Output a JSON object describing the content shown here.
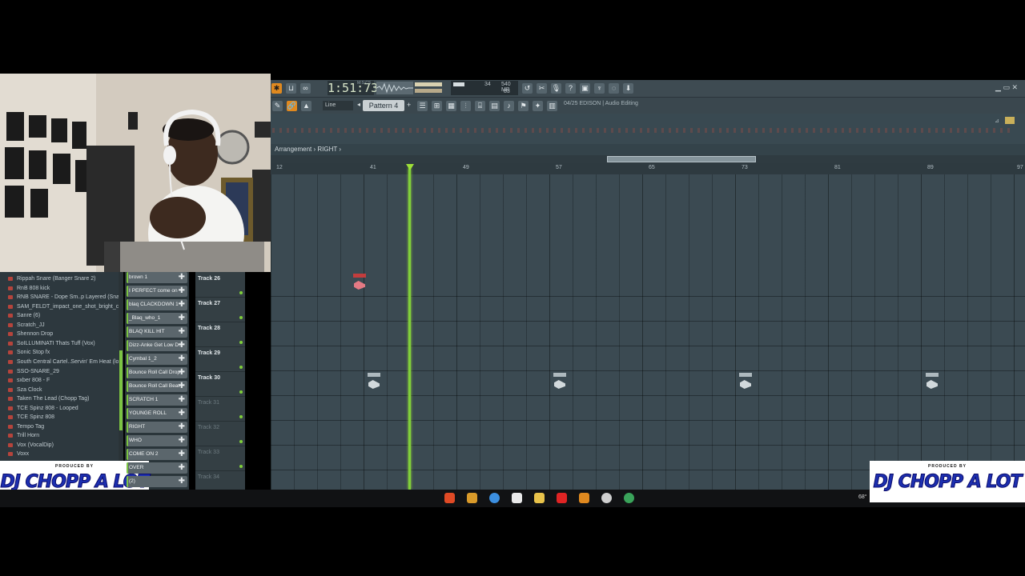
{
  "toolbar": {
    "time": "1:51:73",
    "time_label": "M:S:CS",
    "pattern": "Pattern 4",
    "snap": "Line",
    "monitor_voices": "34",
    "monitor_mem": "540 MB",
    "monitor_cpu": "83",
    "hint": "04/25 EDISON | Audio Editing"
  },
  "playlist": {
    "breadcrumb": "Arrangement › RIGHT ›",
    "tracks": [
      {
        "name": "Track 26",
        "active": true
      },
      {
        "name": "Track 27",
        "active": true
      },
      {
        "name": "Track 28",
        "active": true
      },
      {
        "name": "Track 29",
        "active": true
      },
      {
        "name": "Track 30",
        "active": true
      },
      {
        "name": "Track 31",
        "active": false
      },
      {
        "name": "Track 32",
        "active": false
      },
      {
        "name": "Track 33",
        "active": false
      },
      {
        "name": "Track 34",
        "active": false
      }
    ]
  },
  "browser": {
    "items": [
      "Rippah Snare (Banger Snare 2)",
      "RnB 808 kick",
      "RNB SNARE - Dope Sm..p Layered (Snare)_2",
      "SAM_FELDT_impact_one_shot_bright_clap",
      "Sanre (6)",
      "Scratch_JJ",
      "Shennon Drop",
      "SoILLUMINATI Thats Tuff (Vox)",
      "Sonic Stop fx",
      "South Central Cartel..Servin' Em Heat (loop)",
      "SSO-SNARE_29",
      "sxber 808 - F",
      "Sza Clock",
      "Taken The Lead (Chopp Tag)",
      "TCE Spinz 808 - Looped",
      "TCE Spinz 808",
      "Tempo Tag",
      "Trill Horn",
      "Vox (VocalDip)",
      "Voxx"
    ]
  },
  "picker": {
    "items": [
      "brown 1",
      "I PERFECT come on",
      "blaq CLACKDOWN 1",
      "_Blaq_who_1",
      "BLAQ KILL HIT",
      "Dizz-Anke Get Low D..",
      "Cymbal 1_2",
      "Bounce Roll Call Drop",
      "Bounce Roll Call Beat",
      "SCRATCH 1",
      "YOUNGE ROLL",
      "RIGHT",
      "WHO",
      "COME ON 2",
      "OVER",
      "(2)"
    ]
  },
  "logos": {
    "produced_by": "PRODUCED BY",
    "name": "DJ CHOPP A LOT"
  },
  "tray": {
    "temp": "68°"
  }
}
